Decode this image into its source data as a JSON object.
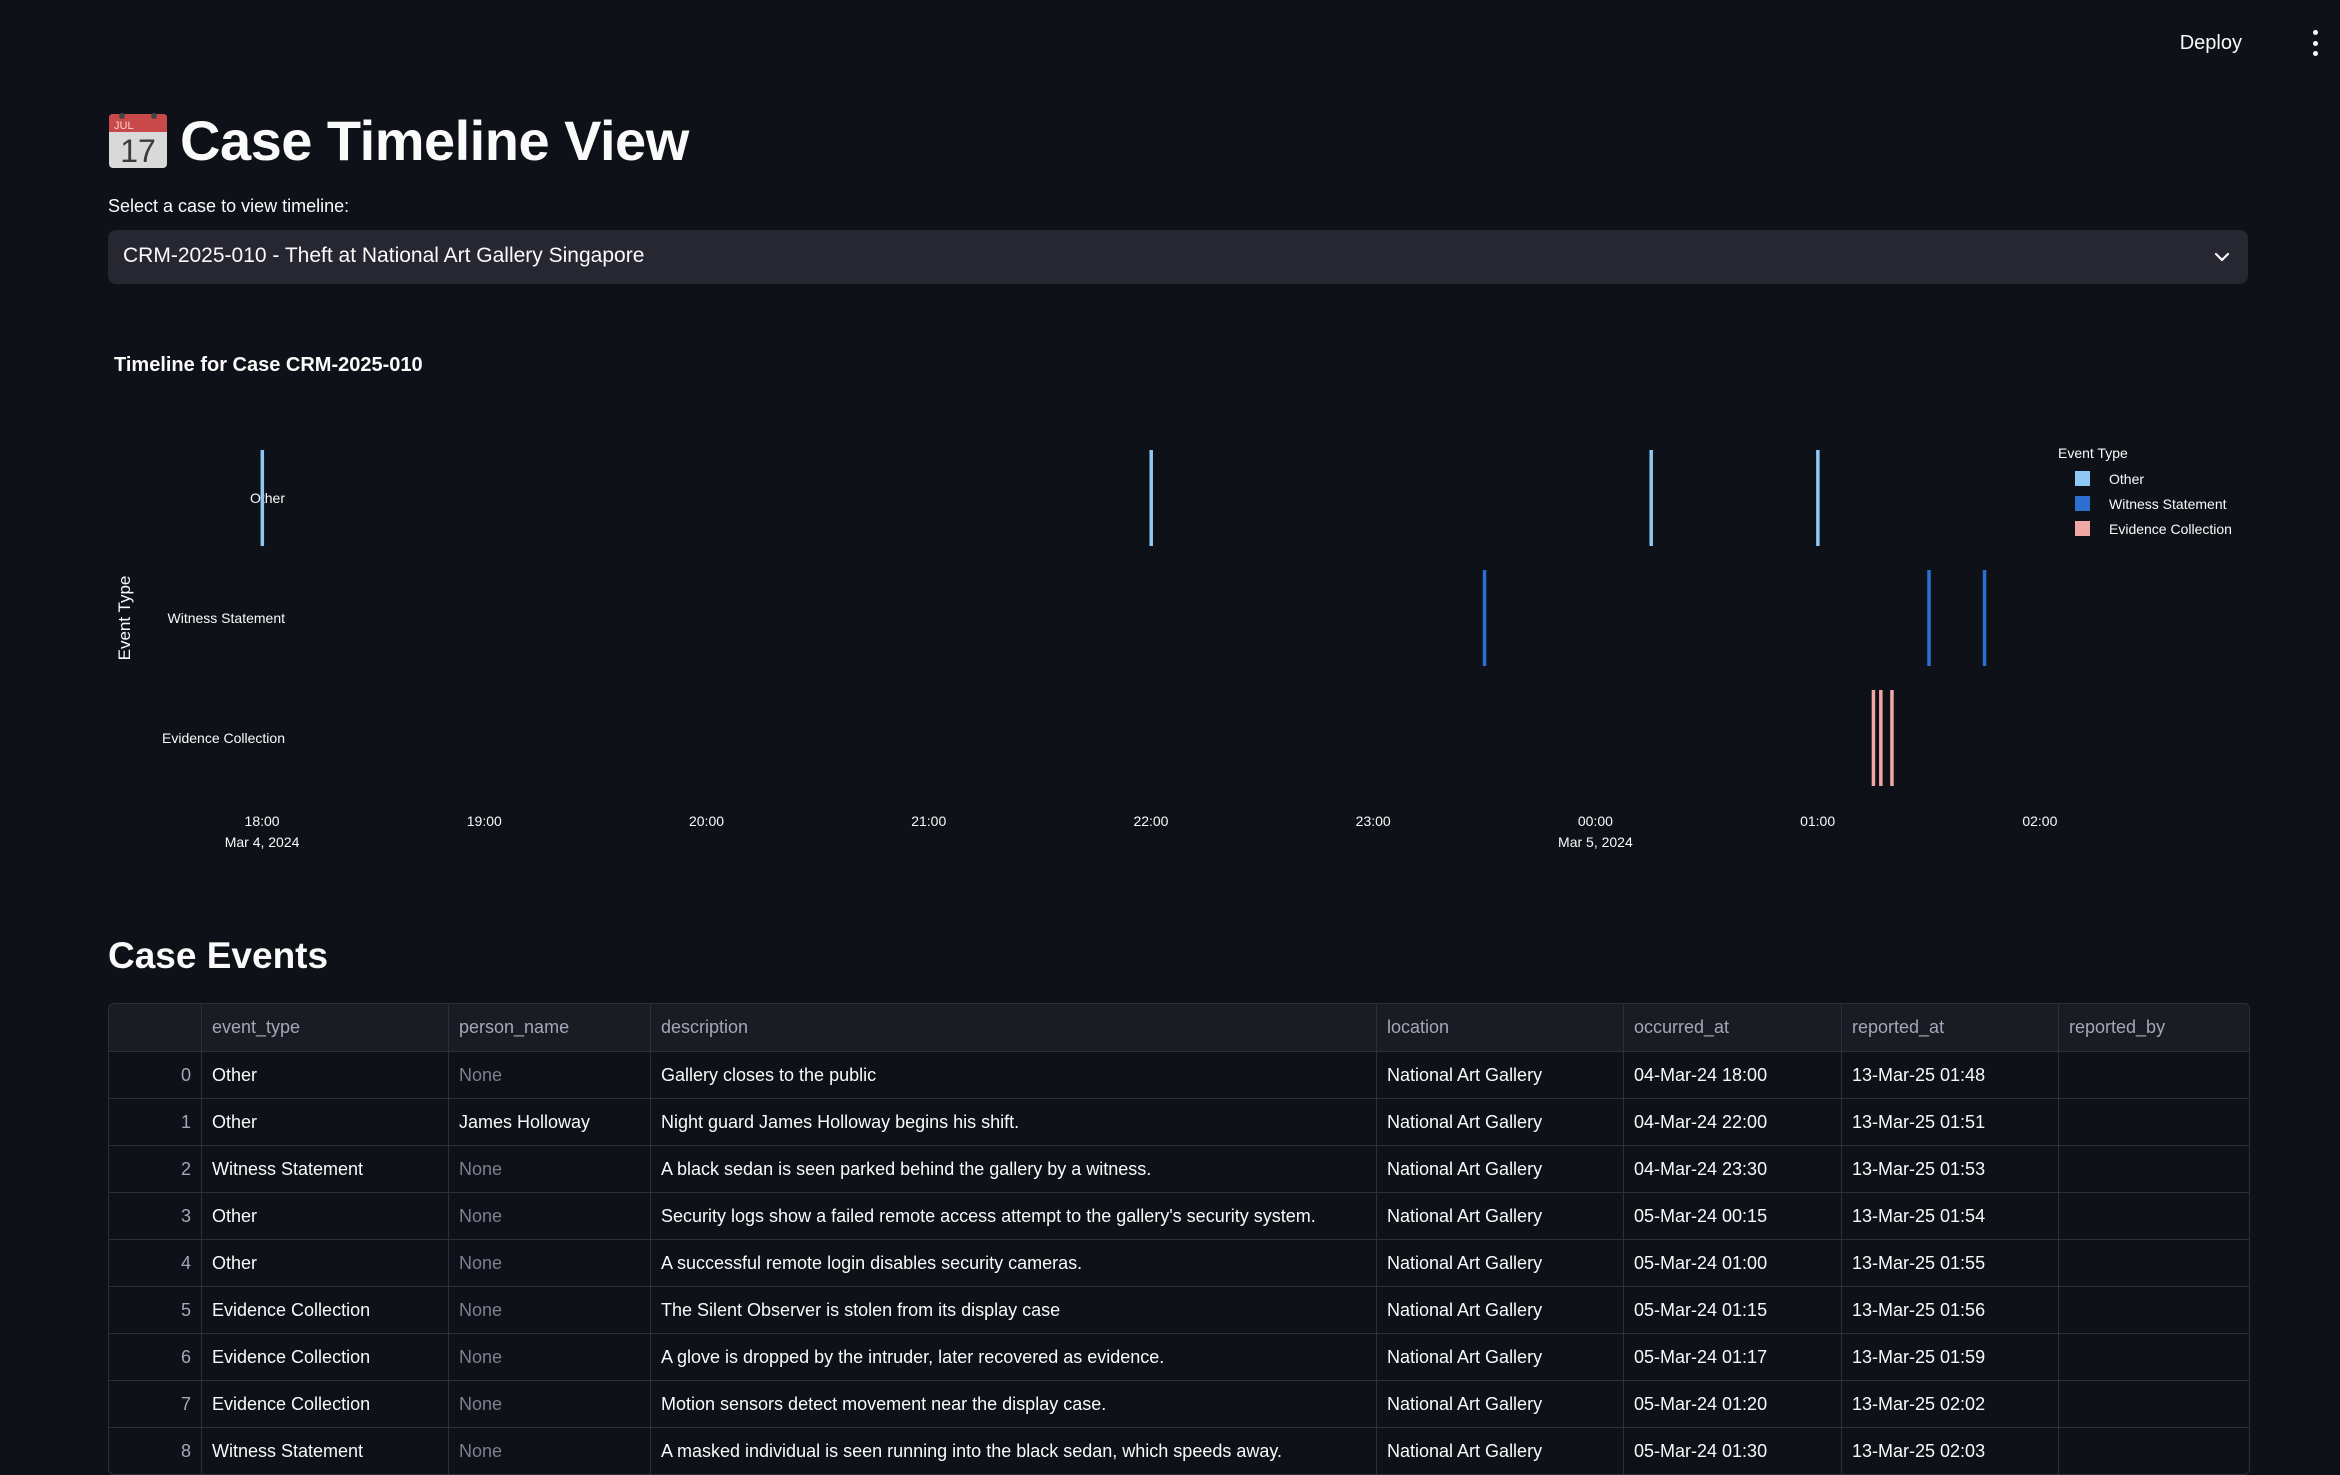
{
  "header": {
    "deploy_label": "Deploy"
  },
  "page": {
    "title": "Case Timeline View",
    "icon_text": {
      "month": "JUL",
      "day": "17"
    }
  },
  "case_select": {
    "label": "Select a case to view timeline:",
    "value": "CRM-2025-010 - Theft at National Art Gallery Singapore"
  },
  "chart_data": {
    "type": "timeline",
    "title": "Timeline for Case CRM-2025-010",
    "ylabel": "Event Type",
    "categories": [
      "Other",
      "Witness Statement",
      "Evidence Collection"
    ],
    "x_range": [
      "2024-03-04 17:40",
      "2024-03-05 02:40"
    ],
    "x_ticks": [
      {
        "t": "2024-03-04 18:00",
        "label": "18:00",
        "sublabel": "Mar 4, 2024"
      },
      {
        "t": "2024-03-04 19:00",
        "label": "19:00",
        "sublabel": ""
      },
      {
        "t": "2024-03-04 20:00",
        "label": "20:00",
        "sublabel": ""
      },
      {
        "t": "2024-03-04 21:00",
        "label": "21:00",
        "sublabel": ""
      },
      {
        "t": "2024-03-04 22:00",
        "label": "22:00",
        "sublabel": ""
      },
      {
        "t": "2024-03-04 23:00",
        "label": "23:00",
        "sublabel": ""
      },
      {
        "t": "2024-03-05 00:00",
        "label": "00:00",
        "sublabel": "Mar 5, 2024"
      },
      {
        "t": "2024-03-05 01:00",
        "label": "01:00",
        "sublabel": ""
      },
      {
        "t": "2024-03-05 02:00",
        "label": "02:00",
        "sublabel": ""
      }
    ],
    "legend": {
      "title": "Event Type",
      "position": "top-right",
      "items": [
        {
          "name": "Other",
          "color": "#8fc7f5"
        },
        {
          "name": "Witness Statement",
          "color": "#2b6fd1"
        },
        {
          "name": "Evidence Collection",
          "color": "#f2a7a7"
        }
      ]
    },
    "series": [
      {
        "name": "Other",
        "color": "#8fc7f5",
        "times": [
          "2024-03-04 18:00",
          "2024-03-04 22:00",
          "2024-03-05 00:15",
          "2024-03-05 01:00"
        ]
      },
      {
        "name": "Witness Statement",
        "color": "#2b6fd1",
        "times": [
          "2024-03-04 23:30",
          "2024-03-05 01:30",
          "2024-03-05 01:45"
        ]
      },
      {
        "name": "Evidence Collection",
        "color": "#f2a7a7",
        "times": [
          "2024-03-05 01:15",
          "2024-03-05 01:17",
          "2024-03-05 01:20"
        ]
      }
    ]
  },
  "events_section": {
    "title": "Case Events",
    "columns": [
      "",
      "event_type",
      "person_name",
      "description",
      "location",
      "occurred_at",
      "reported_at",
      "reported_by"
    ],
    "rows": [
      [
        "0",
        "Other",
        "None",
        "Gallery closes to the public",
        "National Art Gallery",
        "04-Mar-24 18:00",
        "13-Mar-25 01:48",
        ""
      ],
      [
        "1",
        "Other",
        "James Holloway",
        "Night guard James Holloway begins his shift.",
        "National Art Gallery",
        "04-Mar-24 22:00",
        "13-Mar-25 01:51",
        ""
      ],
      [
        "2",
        "Witness Statement",
        "None",
        "A black sedan is seen parked behind the gallery by a witness.",
        "National Art Gallery",
        "04-Mar-24 23:30",
        "13-Mar-25 01:53",
        ""
      ],
      [
        "3",
        "Other",
        "None",
        "Security logs show a failed remote access attempt to the gallery's security system.",
        "National Art Gallery",
        "05-Mar-24 00:15",
        "13-Mar-25 01:54",
        ""
      ],
      [
        "4",
        "Other",
        "None",
        "A successful remote login disables security cameras.",
        "National Art Gallery",
        "05-Mar-24 01:00",
        "13-Mar-25 01:55",
        ""
      ],
      [
        "5",
        "Evidence Collection",
        "None",
        "The Silent Observer is stolen from its display case",
        "National Art Gallery",
        "05-Mar-24 01:15",
        "13-Mar-25 01:56",
        ""
      ],
      [
        "6",
        "Evidence Collection",
        "None",
        "A glove is dropped by the intruder, later recovered as evidence.",
        "National Art Gallery",
        "05-Mar-24 01:17",
        "13-Mar-25 01:59",
        ""
      ],
      [
        "7",
        "Evidence Collection",
        "None",
        "Motion sensors detect movement near the display case.",
        "National Art Gallery",
        "05-Mar-24 01:20",
        "13-Mar-25 02:02",
        ""
      ],
      [
        "8",
        "Witness Statement",
        "None",
        "A masked individual is seen running into the black sedan, which speeds away.",
        "National Art Gallery",
        "05-Mar-24 01:30",
        "13-Mar-25 02:03",
        ""
      ]
    ]
  },
  "icons": {
    "calendar": "calendar-icon",
    "chevron": "chevron-down-icon",
    "menu": "kebab-menu-icon"
  }
}
